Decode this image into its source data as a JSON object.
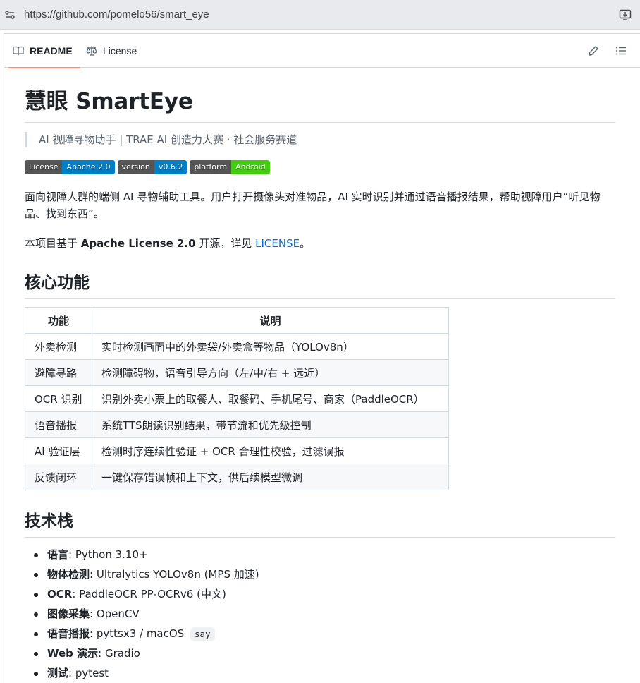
{
  "browser": {
    "url": "https://github.com/pomelo56/smart_eye"
  },
  "tabs": {
    "readme": "README",
    "license": "License"
  },
  "readme": {
    "title": "慧眼 SmartEye",
    "tagline": "AI 视障寻物助手 | TRAE AI 创造力大赛 · 社会服务赛道",
    "badges": [
      {
        "label": "License",
        "value": "Apache 2.0",
        "color": "#007ec6"
      },
      {
        "label": "version",
        "value": "v0.6.2",
        "color": "#007ec6"
      },
      {
        "label": "platform",
        "value": "Android",
        "color": "#4c1"
      }
    ],
    "intro": "面向视障人群的端侧 AI 寻物辅助工具。用户打开摄像头对准物品，AI 实时识别并通过语音播报结果，帮助视障用户“听见物品、找到东西”。",
    "license_line": {
      "prefix": "本项目基于 ",
      "bold": "Apache License 2.0",
      "middle": " 开源，详见 ",
      "link": "LICENSE",
      "suffix": "。"
    },
    "features_heading": "核心功能",
    "features_table": {
      "headers": [
        "功能",
        "说明"
      ],
      "rows": [
        [
          "外卖检测",
          "实时检测画面中的外卖袋/外卖盒等物品（YOLOv8n）"
        ],
        [
          "避障寻路",
          "检测障碍物，语音引导方向（左/中/右 + 远近）"
        ],
        [
          "OCR 识别",
          "识别外卖小票上的取餐人、取餐码、手机尾号、商家（PaddleOCR）"
        ],
        [
          "语音播报",
          "系统TTS朗读识别结果，带节流和优先级控制"
        ],
        [
          "AI 验证层",
          "检测时序连续性验证 + OCR 合理性校验，过滤误报"
        ],
        [
          "反馈闭环",
          "一键保存错误帧和上下文，供后续模型微调"
        ]
      ]
    },
    "stack_heading": "技术栈",
    "stack": [
      {
        "key": "语言",
        "value": ": Python 3.10+"
      },
      {
        "key": "物体检测",
        "value": ": Ultralytics YOLOv8n (MPS 加速)"
      },
      {
        "key": "OCR",
        "value": ": PaddleOCR PP-OCRv6 (中文)"
      },
      {
        "key": "图像采集",
        "value": ": OpenCV"
      },
      {
        "key": "语音播报",
        "value": ": pyttsx3 / macOS ",
        "code": "say"
      },
      {
        "key": "Web 演示",
        "value": ": Gradio"
      },
      {
        "key": "测试",
        "value": ": pytest"
      }
    ]
  }
}
